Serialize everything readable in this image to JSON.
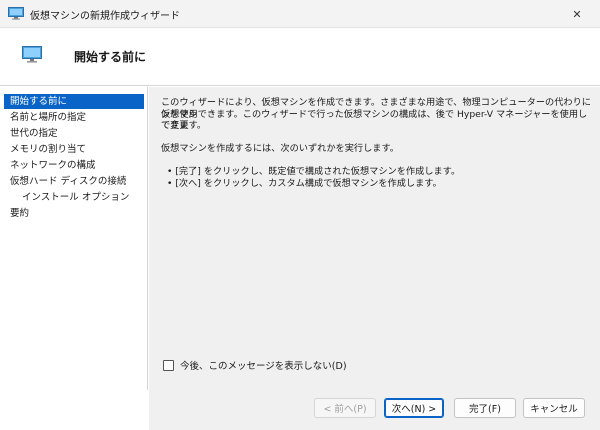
{
  "window": {
    "title": "仮想マシンの新規作成ウィザード",
    "icon": "monitor-icon",
    "close_glyph": "✕"
  },
  "header": {
    "title": "開始する前に",
    "icon": "monitor-icon"
  },
  "nav": {
    "items": [
      {
        "label": "開始する前に",
        "selected": true
      },
      {
        "label": "名前と場所の指定"
      },
      {
        "label": "世代の指定"
      },
      {
        "label": "メモリの割り当て"
      },
      {
        "label": "ネットワークの構成"
      },
      {
        "label": "仮想ハード ディスクの接続"
      },
      {
        "label": "インストール オプション"
      },
      {
        "label": "要約"
      }
    ]
  },
  "content": {
    "para1_line1": "このウィザードにより、仮想マシンを作成できます。さまざまな用途で、物理コンピューターの代わりに仮想マシ",
    "para1_line2": "ンを使用できます。このウィザードで行った仮想マシンの構成は、後で Hyper-V マネージャーを使用して変更",
    "para1_line3": "できます。",
    "para2": "仮想マシンを作成するには、次のいずれかを実行します。",
    "bullet1": "• [完了] をクリックし、既定値で構成された仮想マシンを作成します。",
    "bullet2": "• [次へ] をクリックし、カスタム構成で仮想マシンを作成します。"
  },
  "checkbox": {
    "label": "今後、このメッセージを表示しない(D)",
    "checked": false
  },
  "buttons": {
    "prev": "< 前へ(P)",
    "next": "次へ(N) >",
    "finish": "完了(F)",
    "cancel": "キャンセル"
  },
  "colors": {
    "accent": "#0a64c8",
    "content_bg": "#f0f0f0"
  }
}
